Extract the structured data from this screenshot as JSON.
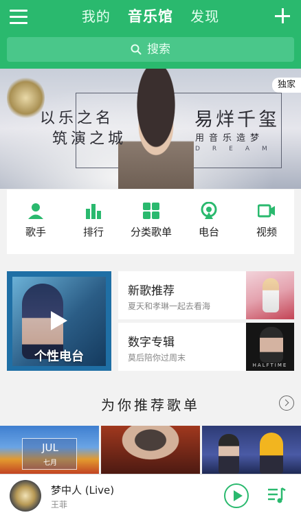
{
  "header": {
    "tabs": [
      {
        "label": "我的",
        "active": false
      },
      {
        "label": "音乐馆",
        "active": true
      },
      {
        "label": "发现",
        "active": false
      }
    ],
    "menu_icon": "hamburger-icon",
    "add_icon": "plus-icon",
    "accent_color": "#2ab96e"
  },
  "search": {
    "icon": "search-icon",
    "placeholder": "搜索"
  },
  "banner": {
    "slogan_line1": "以乐之名",
    "slogan_line2": "筑演之城",
    "title": "易烊千玺",
    "subtitle": "用音乐造梦",
    "subtitle_en": "DREAM",
    "badge": "独家"
  },
  "categories": [
    {
      "label": "歌手",
      "icon": "singer-icon"
    },
    {
      "label": "排行",
      "icon": "chart-icon"
    },
    {
      "label": "分类歌单",
      "icon": "category-icon"
    },
    {
      "label": "电台",
      "icon": "radio-icon"
    },
    {
      "label": "视频",
      "icon": "video-icon"
    }
  ],
  "personal_radio": {
    "label": "个性电台",
    "play_icon": "play-icon"
  },
  "featured": [
    {
      "title": "新歌推荐",
      "subtitle": "夏天和孝琳一起去看海"
    },
    {
      "title": "数字专辑",
      "subtitle": "莫后陪你过周末",
      "thumb_text": "HALFTIME"
    }
  ],
  "recommend": {
    "title": "为你推荐歌单",
    "more_icon": "chevron-right-icon",
    "first_cover_label": "JUL",
    "first_cover_sub": "七月"
  },
  "player": {
    "song": "梦中人 (Live)",
    "artist": "王菲",
    "play_icon": "play-circle-icon",
    "playlist_icon": "playlist-icon"
  }
}
